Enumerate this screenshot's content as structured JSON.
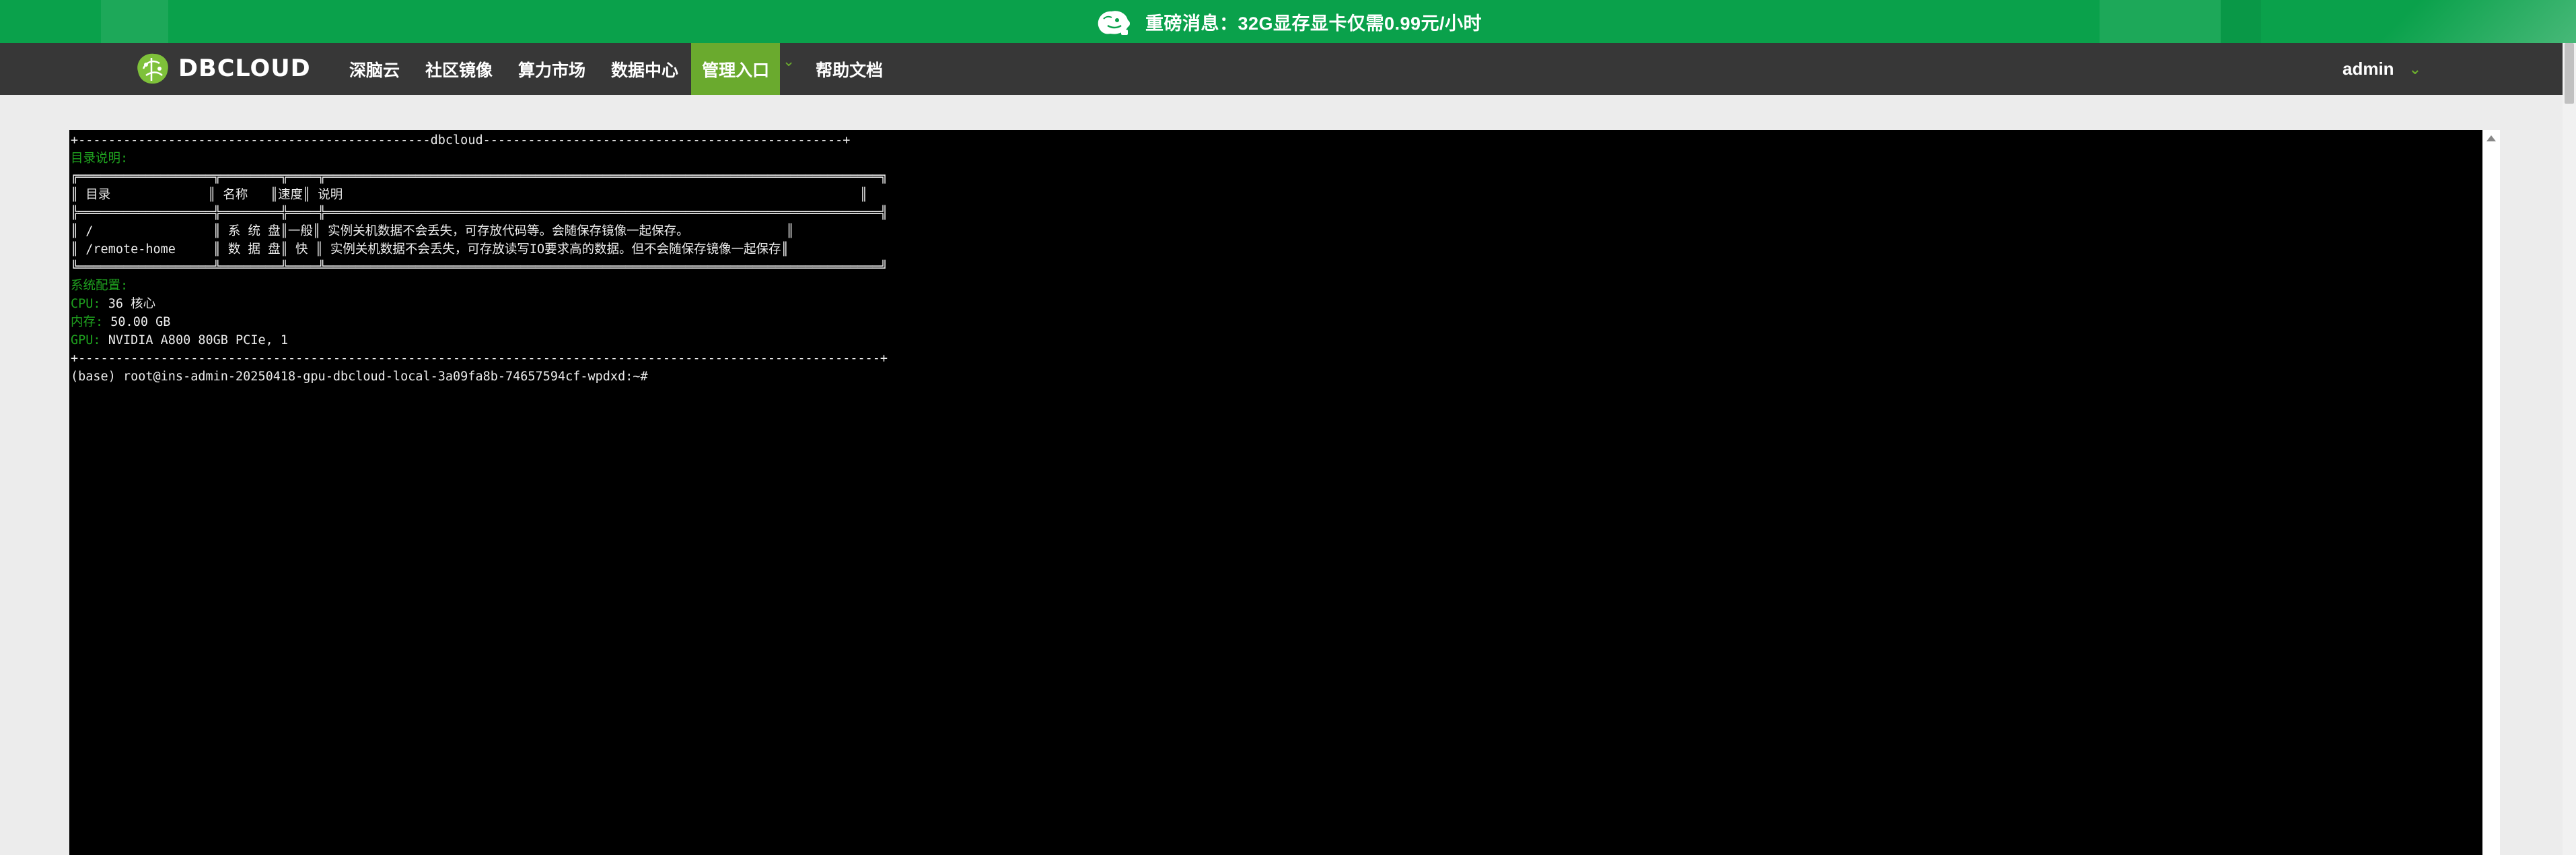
{
  "banner": {
    "text": "重磅消息：32G显存显卡仅需0.99元/小时",
    "icon": "mascot-icon",
    "background": "#0aa14b"
  },
  "navbar": {
    "logo_text": "DBCLOUD",
    "items": [
      {
        "label": "深脑云"
      },
      {
        "label": "社区镜像"
      },
      {
        "label": "算力市场"
      },
      {
        "label": "数据中心"
      },
      {
        "label": "管理入口",
        "active": true
      },
      {
        "label": "帮助文档"
      }
    ],
    "user": "admin",
    "background": "#373737",
    "accent": "#6aaa2e"
  },
  "terminal": {
    "title": "dbcloud",
    "dir_heading": "目录说明:",
    "table": {
      "headers": [
        "目录",
        "名称",
        "速度",
        "说明"
      ],
      "rows": [
        [
          "/",
          "系 统 盘",
          "一般",
          "实例关机数据不会丢失，可存放代码等。会随保存镜像一起保存。"
        ],
        [
          "/remote-home",
          "数 据 盘",
          " 快 ",
          "实例关机数据不会丢失，可存放读写IO要求高的数据。但不会随保存镜像一起保存"
        ]
      ]
    },
    "sys_heading": "系统配置:",
    "config": [
      {
        "label": "CPU:",
        "value": " 36 核心"
      },
      {
        "label": "内存:",
        "value": " 50.00 GB"
      },
      {
        "label": "GPU:",
        "value": " NVIDIA A800 80GB PCIe, 1"
      }
    ],
    "prompt": "(base) root@ins-admin-20250418-gpu-dbcloud-local-3a09fa8b-74657594cf-wpdxd:~#",
    "colors": {
      "label": "#1fa31f",
      "text": "#ececec"
    }
  }
}
